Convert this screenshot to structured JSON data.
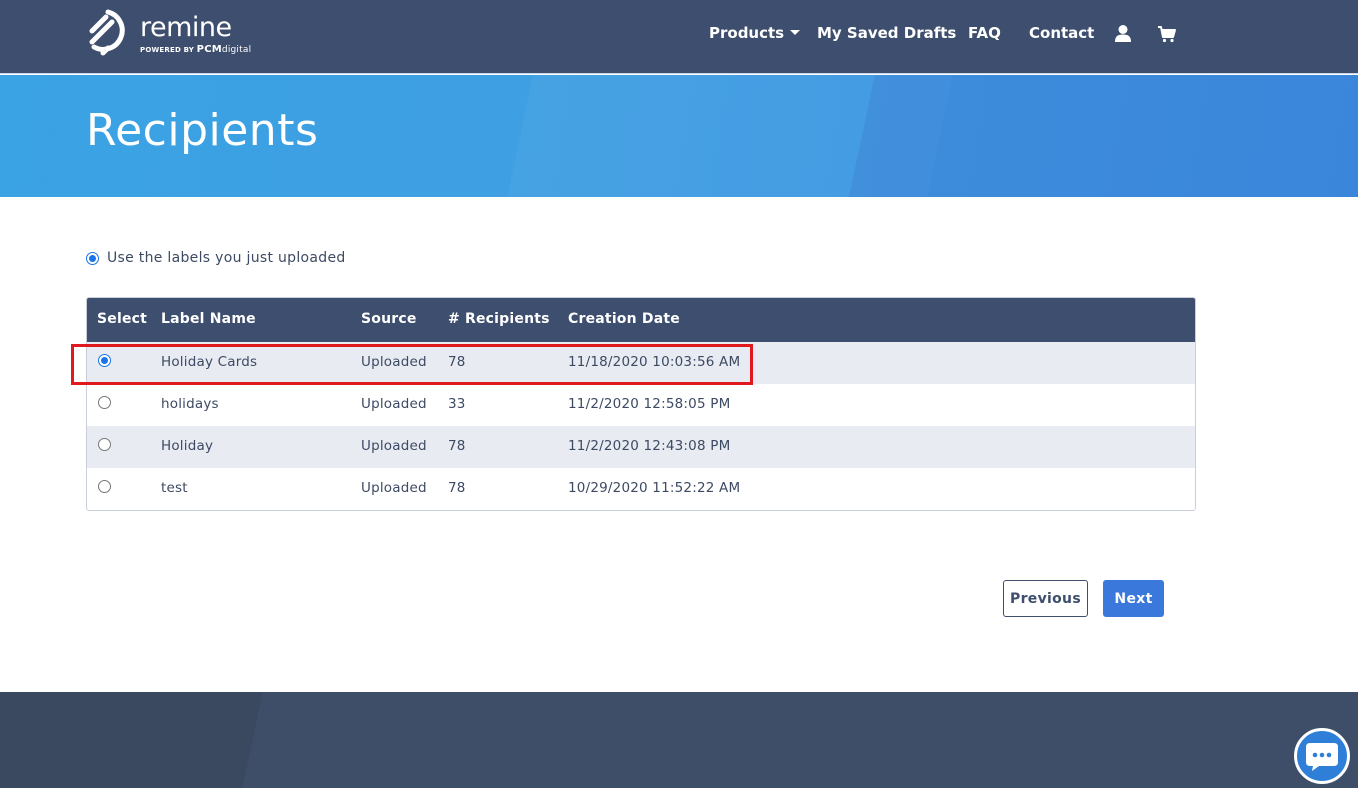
{
  "header": {
    "logo": {
      "word": "remine",
      "sub_prefix": "POWERED BY",
      "sub_brand": "PCM",
      "sub_suffix": "digital"
    },
    "nav": [
      {
        "label": "Products",
        "has_dropdown": true
      },
      {
        "label": "My Saved Drafts"
      },
      {
        "label": "FAQ"
      },
      {
        "label": "Contact"
      }
    ],
    "icons": [
      "user-icon",
      "cart-icon"
    ]
  },
  "hero": {
    "title": "Recipients"
  },
  "label_option": {
    "label": "Use the labels you just uploaded",
    "checked": true
  },
  "table": {
    "headers": [
      "Select",
      "Label Name",
      "Source",
      "# Recipients",
      "Creation Date"
    ],
    "rows": [
      {
        "selected": true,
        "label_name": "Holiday Cards",
        "source": "Uploaded",
        "recipients": "78",
        "creation_date": "11/18/2020 10:03:56 AM"
      },
      {
        "selected": false,
        "label_name": "holidays",
        "source": "Uploaded",
        "recipients": "33",
        "creation_date": "11/2/2020 12:58:05 PM"
      },
      {
        "selected": false,
        "label_name": "Holiday",
        "source": "Uploaded",
        "recipients": "78",
        "creation_date": "11/2/2020 12:43:08 PM"
      },
      {
        "selected": false,
        "label_name": "test",
        "source": "Uploaded",
        "recipients": "78",
        "creation_date": "10/29/2020 11:52:22 AM"
      }
    ]
  },
  "buttons": {
    "previous": "Previous",
    "next": "Next"
  },
  "colors": {
    "navbar": "#3e4e6e",
    "hero": "#3aa3e3",
    "accent": "#3a78dc",
    "highlight": "#e0191f"
  }
}
